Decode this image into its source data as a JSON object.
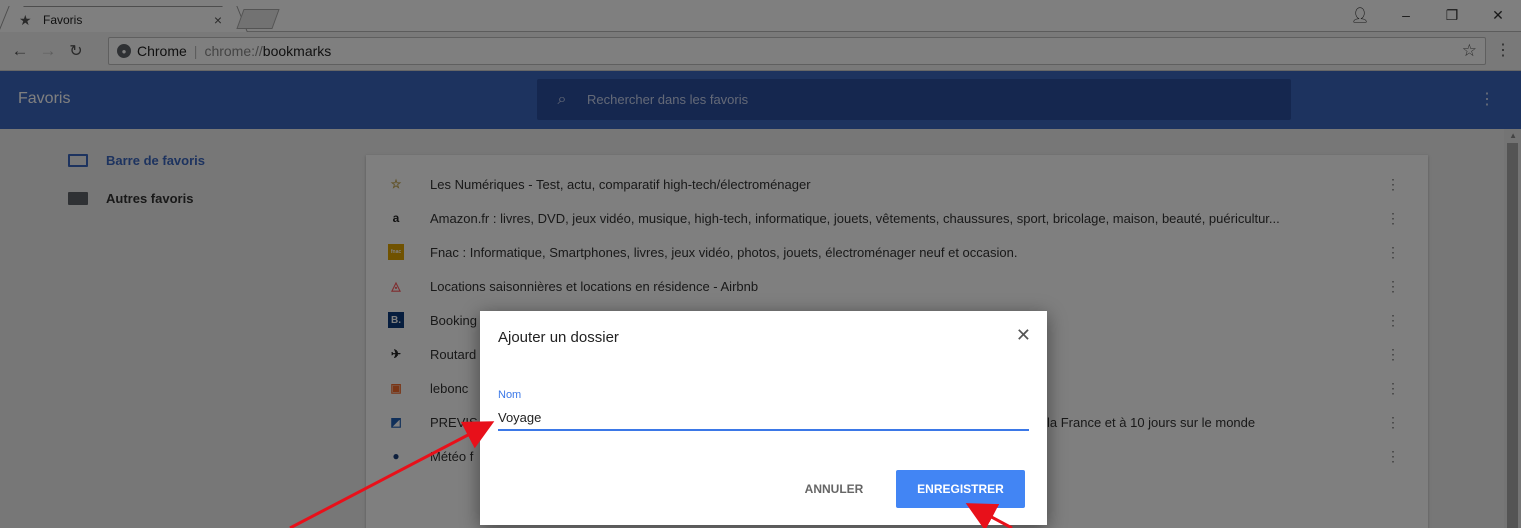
{
  "browser": {
    "tab_title": "Favoris",
    "tab_close": "×",
    "omnibox_site": "Chrome",
    "omnibox_separator": "|",
    "omnibox_scheme": "chrome://",
    "omnibox_path": "bookmarks"
  },
  "app": {
    "title": "Favoris",
    "search_placeholder": "Rechercher dans les favoris"
  },
  "sidebar": {
    "items": [
      {
        "label": "Barre de favoris",
        "active": true
      },
      {
        "label": "Autres favoris",
        "active": false
      }
    ]
  },
  "bookmarks": [
    {
      "icon": "star-favicon",
      "glyph": "☆",
      "color": "#c0a24a",
      "title": "Les Numériques - Test, actu, comparatif high-tech/électroménager"
    },
    {
      "icon": "amazon-favicon",
      "glyph": "a",
      "color": "#222222",
      "title": "Amazon.fr : livres, DVD, jeux vidéo, musique, high-tech, informatique, jouets, vêtements, chaussures, sport, bricolage, maison, beauté, puéricultur..."
    },
    {
      "icon": "fnac-favicon",
      "glyph": "fnac",
      "color": "#e1a400",
      "title": "Fnac : Informatique, Smartphones, livres, jeux vidéo, photos, jouets, électroménager neuf et occasion."
    },
    {
      "icon": "airbnb-favicon",
      "glyph": "◬",
      "color": "#ff5a5f",
      "title": "Locations saisonnières et locations en résidence - Airbnb"
    },
    {
      "icon": "booking-favicon",
      "glyph": "B.",
      "color": "#0c3b7c",
      "title": "Booking"
    },
    {
      "icon": "routard-favicon",
      "glyph": "✈",
      "color": "#222222",
      "title": "Routard"
    },
    {
      "icon": "leboncoin-favicon",
      "glyph": "▣",
      "color": "#f56b2a",
      "title": "lebonc"
    },
    {
      "icon": "previsions-favicon",
      "glyph": "◩",
      "color": "#1f5fb4",
      "title": "PREVIS"
    },
    {
      "icon": "meteo-favicon",
      "glyph": "●",
      "color": "#1a3f7a",
      "title": "Météo f"
    }
  ],
  "bookmark_partial_text": "la France et à 10 jours sur le monde",
  "dialog": {
    "title": "Ajouter un dossier",
    "field_label": "Nom",
    "field_value": "Voyage",
    "cancel_label": "ANNULER",
    "save_label": "ENREGISTRER"
  },
  "colors": {
    "header_blue": "#3b66be",
    "search_blue": "#2a4e9f",
    "accent": "#4285f4",
    "annotation_red": "#e8101a"
  }
}
